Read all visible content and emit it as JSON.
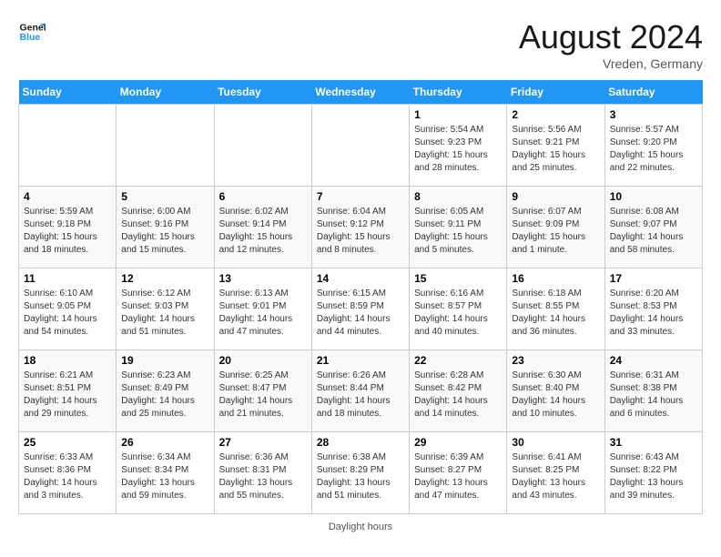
{
  "header": {
    "logo_general": "General",
    "logo_blue": "Blue",
    "month_year": "August 2024",
    "location": "Vreden, Germany"
  },
  "footer": {
    "note": "Daylight hours"
  },
  "weekdays": [
    "Sunday",
    "Monday",
    "Tuesday",
    "Wednesday",
    "Thursday",
    "Friday",
    "Saturday"
  ],
  "weeks": [
    [
      {
        "day": "",
        "info": ""
      },
      {
        "day": "",
        "info": ""
      },
      {
        "day": "",
        "info": ""
      },
      {
        "day": "",
        "info": ""
      },
      {
        "day": "1",
        "info": "Sunrise: 5:54 AM\nSunset: 9:23 PM\nDaylight: 15 hours\nand 28 minutes."
      },
      {
        "day": "2",
        "info": "Sunrise: 5:56 AM\nSunset: 9:21 PM\nDaylight: 15 hours\nand 25 minutes."
      },
      {
        "day": "3",
        "info": "Sunrise: 5:57 AM\nSunset: 9:20 PM\nDaylight: 15 hours\nand 22 minutes."
      }
    ],
    [
      {
        "day": "4",
        "info": "Sunrise: 5:59 AM\nSunset: 9:18 PM\nDaylight: 15 hours\nand 18 minutes."
      },
      {
        "day": "5",
        "info": "Sunrise: 6:00 AM\nSunset: 9:16 PM\nDaylight: 15 hours\nand 15 minutes."
      },
      {
        "day": "6",
        "info": "Sunrise: 6:02 AM\nSunset: 9:14 PM\nDaylight: 15 hours\nand 12 minutes."
      },
      {
        "day": "7",
        "info": "Sunrise: 6:04 AM\nSunset: 9:12 PM\nDaylight: 15 hours\nand 8 minutes."
      },
      {
        "day": "8",
        "info": "Sunrise: 6:05 AM\nSunset: 9:11 PM\nDaylight: 15 hours\nand 5 minutes."
      },
      {
        "day": "9",
        "info": "Sunrise: 6:07 AM\nSunset: 9:09 PM\nDaylight: 15 hours\nand 1 minute."
      },
      {
        "day": "10",
        "info": "Sunrise: 6:08 AM\nSunset: 9:07 PM\nDaylight: 14 hours\nand 58 minutes."
      }
    ],
    [
      {
        "day": "11",
        "info": "Sunrise: 6:10 AM\nSunset: 9:05 PM\nDaylight: 14 hours\nand 54 minutes."
      },
      {
        "day": "12",
        "info": "Sunrise: 6:12 AM\nSunset: 9:03 PM\nDaylight: 14 hours\nand 51 minutes."
      },
      {
        "day": "13",
        "info": "Sunrise: 6:13 AM\nSunset: 9:01 PM\nDaylight: 14 hours\nand 47 minutes."
      },
      {
        "day": "14",
        "info": "Sunrise: 6:15 AM\nSunset: 8:59 PM\nDaylight: 14 hours\nand 44 minutes."
      },
      {
        "day": "15",
        "info": "Sunrise: 6:16 AM\nSunset: 8:57 PM\nDaylight: 14 hours\nand 40 minutes."
      },
      {
        "day": "16",
        "info": "Sunrise: 6:18 AM\nSunset: 8:55 PM\nDaylight: 14 hours\nand 36 minutes."
      },
      {
        "day": "17",
        "info": "Sunrise: 6:20 AM\nSunset: 8:53 PM\nDaylight: 14 hours\nand 33 minutes."
      }
    ],
    [
      {
        "day": "18",
        "info": "Sunrise: 6:21 AM\nSunset: 8:51 PM\nDaylight: 14 hours\nand 29 minutes."
      },
      {
        "day": "19",
        "info": "Sunrise: 6:23 AM\nSunset: 8:49 PM\nDaylight: 14 hours\nand 25 minutes."
      },
      {
        "day": "20",
        "info": "Sunrise: 6:25 AM\nSunset: 8:47 PM\nDaylight: 14 hours\nand 21 minutes."
      },
      {
        "day": "21",
        "info": "Sunrise: 6:26 AM\nSunset: 8:44 PM\nDaylight: 14 hours\nand 18 minutes."
      },
      {
        "day": "22",
        "info": "Sunrise: 6:28 AM\nSunset: 8:42 PM\nDaylight: 14 hours\nand 14 minutes."
      },
      {
        "day": "23",
        "info": "Sunrise: 6:30 AM\nSunset: 8:40 PM\nDaylight: 14 hours\nand 10 minutes."
      },
      {
        "day": "24",
        "info": "Sunrise: 6:31 AM\nSunset: 8:38 PM\nDaylight: 14 hours\nand 6 minutes."
      }
    ],
    [
      {
        "day": "25",
        "info": "Sunrise: 6:33 AM\nSunset: 8:36 PM\nDaylight: 14 hours\nand 3 minutes."
      },
      {
        "day": "26",
        "info": "Sunrise: 6:34 AM\nSunset: 8:34 PM\nDaylight: 13 hours\nand 59 minutes."
      },
      {
        "day": "27",
        "info": "Sunrise: 6:36 AM\nSunset: 8:31 PM\nDaylight: 13 hours\nand 55 minutes."
      },
      {
        "day": "28",
        "info": "Sunrise: 6:38 AM\nSunset: 8:29 PM\nDaylight: 13 hours\nand 51 minutes."
      },
      {
        "day": "29",
        "info": "Sunrise: 6:39 AM\nSunset: 8:27 PM\nDaylight: 13 hours\nand 47 minutes."
      },
      {
        "day": "30",
        "info": "Sunrise: 6:41 AM\nSunset: 8:25 PM\nDaylight: 13 hours\nand 43 minutes."
      },
      {
        "day": "31",
        "info": "Sunrise: 6:43 AM\nSunset: 8:22 PM\nDaylight: 13 hours\nand 39 minutes."
      }
    ]
  ]
}
